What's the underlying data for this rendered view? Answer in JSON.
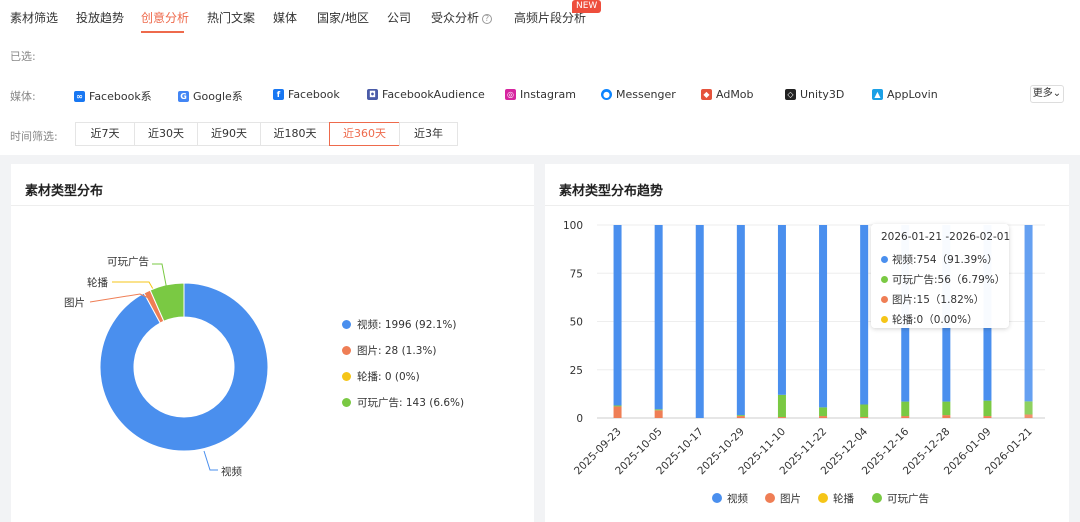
{
  "tabs": [
    {
      "label": "素材筛选",
      "active": false
    },
    {
      "label": "投放趋势",
      "active": false
    },
    {
      "label": "创意分析",
      "active": true
    },
    {
      "label": "热门文案",
      "active": false
    },
    {
      "label": "媒体",
      "active": false
    },
    {
      "label": "国家/地区",
      "active": false
    },
    {
      "label": "公司",
      "active": false
    },
    {
      "label": "受众分析",
      "active": false
    },
    {
      "label": "高频片段分析",
      "active": false
    }
  ],
  "help_glyph": "?",
  "new_badge": "NEW",
  "filters": {
    "selected_label": "已选:",
    "media_label": "媒体:",
    "time_label": "时间筛选:",
    "media": [
      {
        "label": "Facebook系",
        "icon": "meta-icon",
        "glyph": "∞",
        "color": "#1877f2"
      },
      {
        "label": "Google系",
        "icon": "google-icon",
        "glyph": "G",
        "color": "#4285f4"
      },
      {
        "label": "Facebook",
        "icon": "facebook-icon",
        "glyph": "f",
        "color": "#1877f2"
      },
      {
        "label": "FacebookAudience",
        "icon": "facebook-audience-icon",
        "glyph": "◘",
        "color": "#4a5ba8"
      },
      {
        "label": "Instagram",
        "icon": "instagram-icon",
        "glyph": "◎",
        "color": "#d6249f"
      },
      {
        "label": "Messenger",
        "icon": "messenger-icon",
        "glyph": "●",
        "color": "#0b84ff"
      },
      {
        "label": "AdMob",
        "icon": "admob-icon",
        "glyph": "◆",
        "color": "#e5533c"
      },
      {
        "label": "Unity3D",
        "icon": "unity-icon",
        "glyph": "◇",
        "color": "#222222"
      },
      {
        "label": "AppLovin",
        "icon": "applovin-icon",
        "glyph": "▲",
        "color": "#1aa0e6"
      }
    ],
    "more_label": "更多⌄",
    "time": [
      {
        "label": "近7天",
        "active": false
      },
      {
        "label": "近30天",
        "active": false
      },
      {
        "label": "近90天",
        "active": false
      },
      {
        "label": "近180天",
        "active": false
      },
      {
        "label": "近360天",
        "active": true
      },
      {
        "label": "近3年",
        "active": false
      }
    ]
  },
  "pie_card": {
    "title": "素材类型分布",
    "legend": [
      {
        "text": "视频: 1996 (92.1%)",
        "color": "#4a8fee"
      },
      {
        "text": "图片: 28 (1.3%)",
        "color": "#ef7e55"
      },
      {
        "text": "轮播: 0 (0%)",
        "color": "#f5c518"
      },
      {
        "text": "可玩广告: 143 (6.6%)",
        "color": "#7ac943"
      }
    ]
  },
  "trend_card": {
    "title": "素材类型分布趋势",
    "tooltip": {
      "title": "2026-01-21 -2026-02-01",
      "rows": [
        {
          "text": "视频:754（91.39%）",
          "color": "#4a8fee"
        },
        {
          "text": "可玩广告:56（6.79%）",
          "color": "#7ac943"
        },
        {
          "text": "图片:15（1.82%）",
          "color": "#ef7e55"
        },
        {
          "text": "轮播:0（0.00%）",
          "color": "#f5c518"
        }
      ]
    }
  },
  "chart_data": [
    {
      "type": "pie",
      "categories": [
        "视频",
        "图片",
        "轮播",
        "可玩广告"
      ],
      "values": [
        1996,
        28,
        0,
        143
      ],
      "percent": [
        92.1,
        1.3,
        0,
        6.6
      ],
      "colors": [
        "#4a8fee",
        "#ef7e55",
        "#f5c518",
        "#7ac943"
      ],
      "outer_labels": [
        "视频",
        "图片",
        "轮播",
        "可玩广告"
      ],
      "donut": true
    },
    {
      "type": "bar",
      "stacked": true,
      "categories": [
        "2025-09-23",
        "2025-10-05",
        "2025-10-17",
        "2025-10-29",
        "2025-11-10",
        "2025-11-22",
        "2025-12-04",
        "2025-12-16",
        "2025-12-28",
        "2026-01-09",
        "2026-01-21"
      ],
      "series": [
        {
          "name": "视频",
          "color": "#4a8fee",
          "values": [
            93.5,
            95.5,
            100,
            98.5,
            88,
            94.5,
            93,
            91.5,
            91.5,
            91,
            91.39
          ]
        },
        {
          "name": "图片",
          "color": "#ef7e55",
          "values": [
            6,
            4,
            0,
            1,
            0.5,
            1,
            0.5,
            1,
            1.5,
            1,
            1.82
          ]
        },
        {
          "name": "轮播",
          "color": "#f5c518",
          "values": [
            0,
            0,
            0,
            0,
            0,
            0,
            0,
            0,
            0,
            0,
            0
          ]
        },
        {
          "name": "可玩广告",
          "color": "#7ac943",
          "values": [
            0.5,
            0.5,
            0,
            0.5,
            11.5,
            4.5,
            6.5,
            7.5,
            7,
            8,
            6.79
          ]
        }
      ],
      "yticks": [
        0,
        25,
        50,
        75,
        100
      ],
      "ylim": [
        0,
        100
      ],
      "grid": true,
      "legend_position": "bottom",
      "highlighted_category": "2026-01-21"
    }
  ]
}
